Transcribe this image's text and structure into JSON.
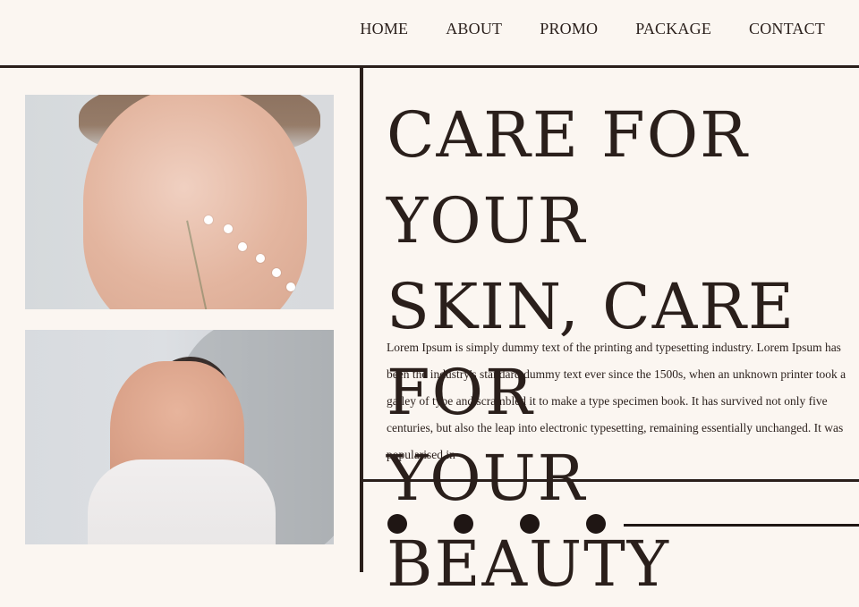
{
  "nav": {
    "items": [
      "HOME",
      "ABOUT",
      "PROMO",
      "PACKAGE",
      "CONTACT"
    ]
  },
  "hero": {
    "headline": "CARE FOR YOUR\nSKIN, CARE FOR\nYOUR BEAUTY",
    "body": "Lorem Ipsum is simply dummy text of the printing and typesetting industry. Lorem Ipsum has been the industry's standard dummy text ever since the 1500s, when an unknown printer took a galley of type and scrambled it to make a type specimen book. It has survived not only five centuries, but also the leap into electronic typesetting, remaining essentially unchanged. It was popularised in"
  },
  "pager": {
    "dots": 4
  },
  "colors": {
    "background": "#fbf6f1",
    "ink": "#2a1f1b"
  }
}
